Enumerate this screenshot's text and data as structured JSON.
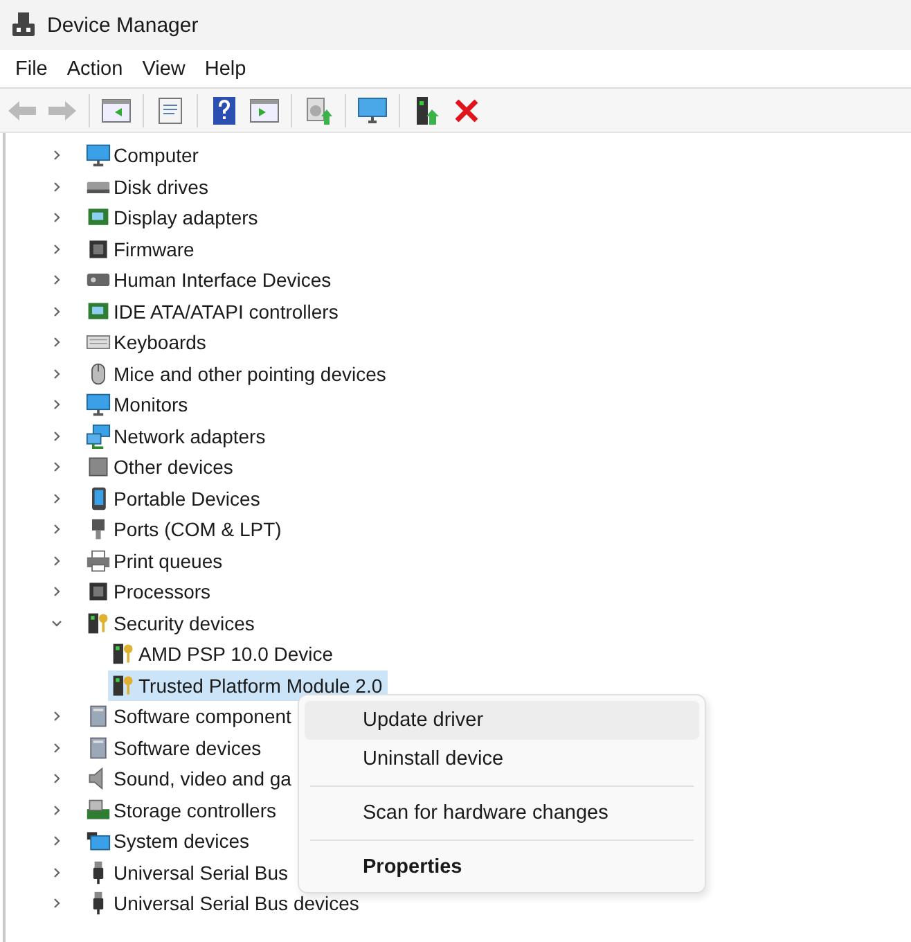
{
  "window": {
    "title": "Device Manager"
  },
  "menu_bar": [
    "File",
    "Action",
    "View",
    "Help"
  ],
  "toolbar": [
    {
      "kind": "back",
      "disabled": true
    },
    {
      "kind": "forward",
      "disabled": true
    },
    {
      "kind": "separator"
    },
    {
      "kind": "panel-left",
      "disabled": false
    },
    {
      "kind": "separator"
    },
    {
      "kind": "properties",
      "disabled": false
    },
    {
      "kind": "separator"
    },
    {
      "kind": "help",
      "disabled": false
    },
    {
      "kind": "panel-right",
      "disabled": false
    },
    {
      "kind": "separator"
    },
    {
      "kind": "scan",
      "disabled": false
    },
    {
      "kind": "separator"
    },
    {
      "kind": "monitor",
      "disabled": false
    },
    {
      "kind": "separator"
    },
    {
      "kind": "update",
      "disabled": false
    },
    {
      "kind": "uninstall",
      "disabled": false
    }
  ],
  "tree": [
    {
      "label": "Computer",
      "expanded": false
    },
    {
      "label": "Disk drives",
      "expanded": false
    },
    {
      "label": "Display adapters",
      "expanded": false
    },
    {
      "label": "Firmware",
      "expanded": false
    },
    {
      "label": "Human Interface Devices",
      "expanded": false
    },
    {
      "label": "IDE ATA/ATAPI controllers",
      "expanded": false
    },
    {
      "label": "Keyboards",
      "expanded": false
    },
    {
      "label": "Mice and other pointing devices",
      "expanded": false
    },
    {
      "label": "Monitors",
      "expanded": false
    },
    {
      "label": "Network adapters",
      "expanded": false
    },
    {
      "label": "Other devices",
      "expanded": false
    },
    {
      "label": "Portable Devices",
      "expanded": false
    },
    {
      "label": "Ports (COM & LPT)",
      "expanded": false
    },
    {
      "label": "Print queues",
      "expanded": false
    },
    {
      "label": "Processors",
      "expanded": false
    },
    {
      "label": "Security devices",
      "expanded": true,
      "children": [
        {
          "label": "AMD PSP 10.0 Device",
          "selected": false
        },
        {
          "label": "Trusted Platform Module 2.0",
          "selected": true
        }
      ]
    },
    {
      "label": "Software component",
      "expanded": false
    },
    {
      "label": "Software devices",
      "expanded": false
    },
    {
      "label": "Sound, video and ga",
      "expanded": false
    },
    {
      "label": "Storage controllers",
      "expanded": false
    },
    {
      "label": "System devices",
      "expanded": false
    },
    {
      "label": "Universal Serial Bus",
      "expanded": false
    },
    {
      "label": "Universal Serial Bus devices",
      "expanded": false
    }
  ],
  "context_menu": {
    "groups": [
      [
        {
          "label": "Update driver",
          "highlighted": true,
          "default": false
        },
        {
          "label": "Uninstall device",
          "highlighted": false,
          "default": false
        }
      ],
      [
        {
          "label": "Scan for hardware changes",
          "highlighted": false,
          "default": false
        }
      ],
      [
        {
          "label": "Properties",
          "highlighted": false,
          "default": true
        }
      ]
    ]
  }
}
